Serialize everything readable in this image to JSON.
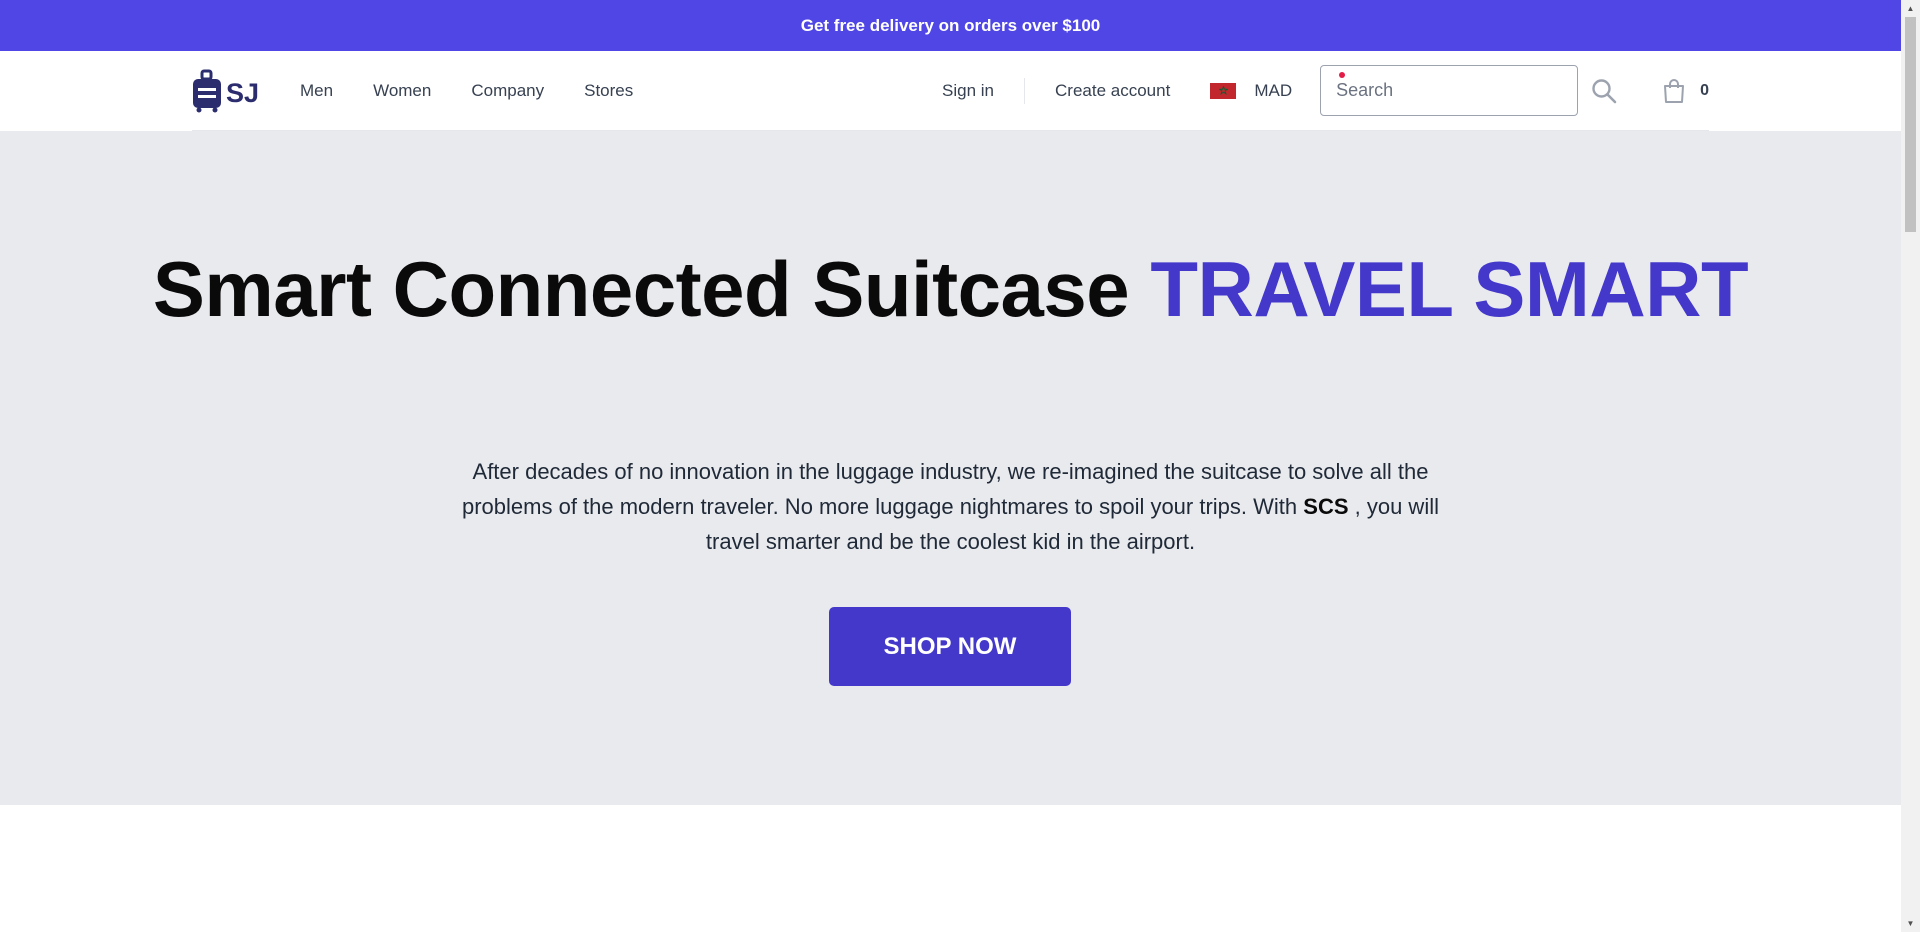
{
  "announcement": {
    "text": "Get free delivery on orders over $100"
  },
  "nav": {
    "logo_text": "SJ",
    "links": [
      "Men",
      "Women",
      "Company",
      "Stores"
    ],
    "sign_in": "Sign in",
    "create_account": "Create account",
    "currency": "MAD",
    "flag_icon": "morocco-flag-icon",
    "search_placeholder": "Search",
    "cart_count": "0"
  },
  "hero": {
    "title_main": "Smart Connected Suitcase",
    "title_accent": "TRAVEL SMART",
    "description_before": "After decades of no innovation in the luggage industry, we re-imagined the suitcase to solve all the problems of the modern traveler. No more luggage nightmares to spoil your trips. With ",
    "description_brand": "SCS",
    "description_after": " , you will travel smarter and be the coolest kid in the airport.",
    "cta_label": "SHOP NOW"
  },
  "colors": {
    "brand": "#4f46e5",
    "accent": "#4338ca",
    "hero_bg": "#e9eaee"
  }
}
